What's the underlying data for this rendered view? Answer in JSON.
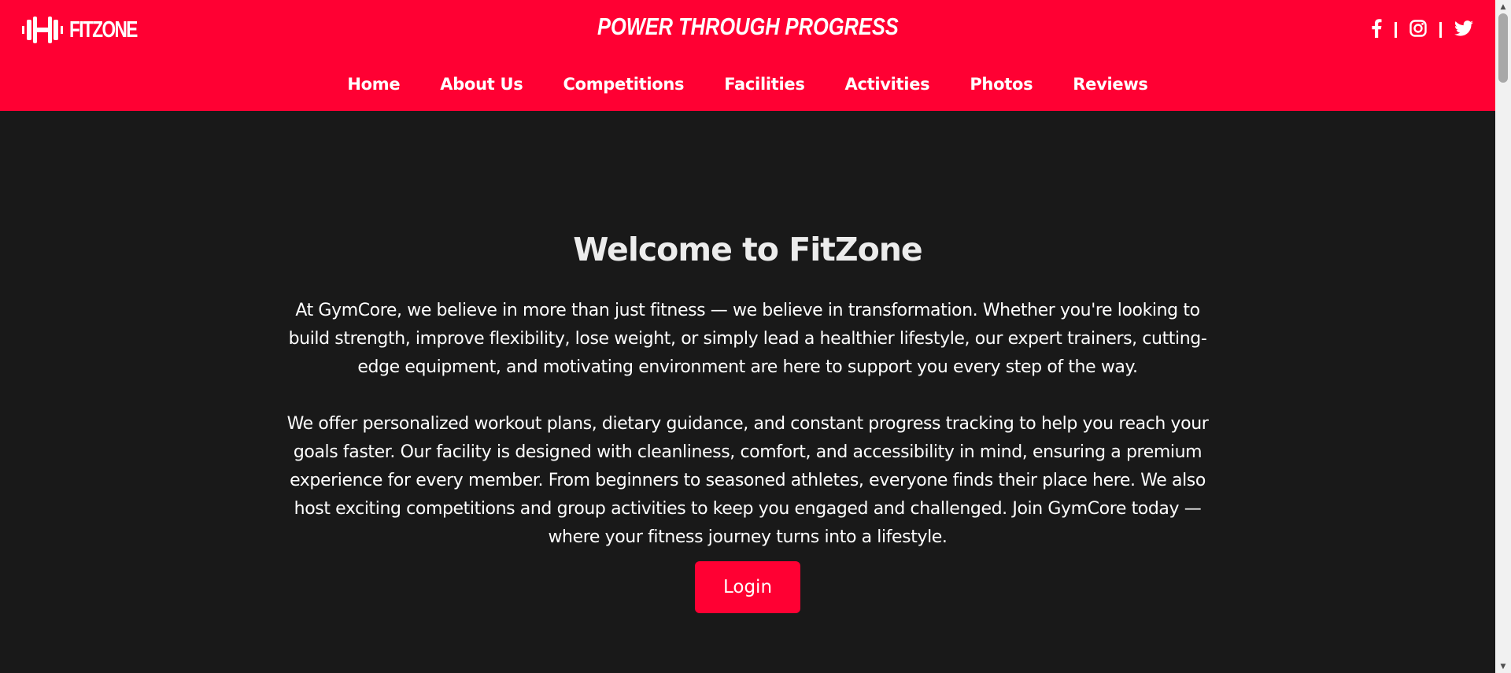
{
  "header": {
    "brand_name": "FITZONE",
    "tagline": "POWER THROUGH PROGRESS",
    "nav": [
      {
        "label": "Home"
      },
      {
        "label": "About Us"
      },
      {
        "label": "Competitions"
      },
      {
        "label": "Facilities"
      },
      {
        "label": "Activities"
      },
      {
        "label": "Photos"
      },
      {
        "label": "Reviews"
      }
    ],
    "social": [
      {
        "icon": "facebook-icon"
      },
      {
        "icon": "instagram-icon"
      },
      {
        "icon": "twitter-icon"
      }
    ]
  },
  "main": {
    "title": "Welcome to FitZone",
    "paragraphs": [
      "At GymCore, we believe in more than just fitness — we believe in transformation. Whether you're looking to build strength, improve flexibility, lose weight, or simply lead a healthier lifestyle, our expert trainers, cutting-edge equipment, and motivating environment are here to support you every step of the way.",
      "We offer personalized workout plans, dietary guidance, and constant progress tracking to help you reach your goals faster. Our facility is designed with cleanliness, comfort, and accessibility in mind, ensuring a premium experience for every member. From beginners to seasoned athletes, everyone finds their place here. We also host exciting competitions and group activities to keep you engaged and challenged. Join GymCore today — where your fitness journey turns into a lifestyle."
    ],
    "login_label": "Login"
  },
  "colors": {
    "accent": "#ff0033",
    "background": "#191919",
    "text": "#ffffff"
  }
}
